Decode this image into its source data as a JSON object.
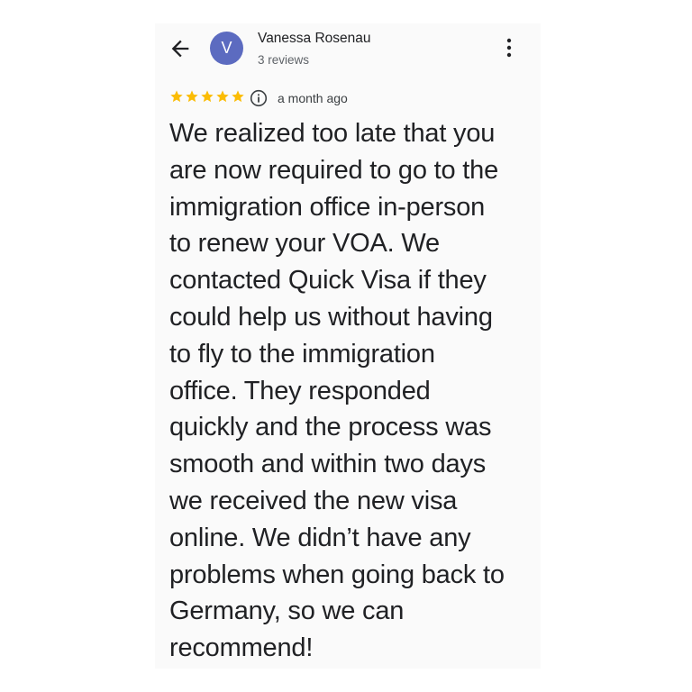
{
  "header": {
    "back_icon": "arrow-back-icon",
    "avatar_initial": "V",
    "avatar_color": "#5c6bc0",
    "reviewer_name": "Vanessa Rosenau",
    "review_count": "3 reviews",
    "menu_icon": "more-vertical-icon"
  },
  "review": {
    "rating": 5,
    "max_rating": 5,
    "star_color": "#fbbc04",
    "info_icon": "info-icon",
    "time": "a month ago",
    "lines": [
      "We realized too late that you",
      "are now required to go to the",
      "immigration office in-person",
      "to renew your VOA. We",
      "contacted Quick Visa if they",
      "could help us without having",
      "to fly to the immigration",
      "office. They responded",
      "quickly and the process was",
      "smooth and within two days",
      "we received the new visa",
      "online. We didn’t have any",
      "problems when going back to",
      "Germany, so we can",
      "recommend!"
    ]
  }
}
